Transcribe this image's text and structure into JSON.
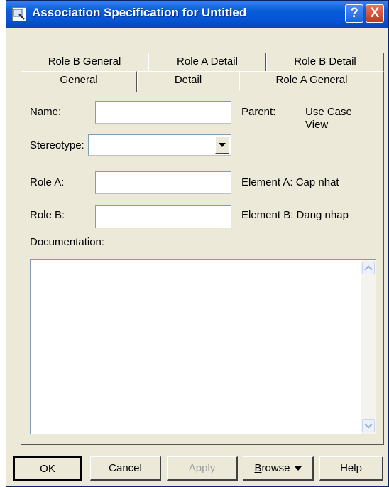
{
  "window": {
    "title": "Association Specification for Untitled",
    "help_glyph": "?",
    "close_glyph": "X"
  },
  "tabs": {
    "back_row": [
      "Role B General",
      "Role A Detail",
      "Role B Detail"
    ],
    "front_row": [
      "General",
      "Detail",
      "Role A General"
    ],
    "active": "General"
  },
  "form": {
    "name_label": "Name:",
    "name_value": "",
    "parent_label": "Parent:",
    "parent_value_line1": "Use Case",
    "parent_value_line2": "View",
    "stereotype_label": "Stereotype:",
    "stereotype_value": "",
    "role_a_label": "Role A:",
    "role_a_value": "",
    "element_a_text": "Element A: Cap nhat",
    "role_b_label": "Role B:",
    "role_b_value": "",
    "element_b_text": "Element B: Dang nhap",
    "documentation_label": "Documentation:",
    "documentation_value": ""
  },
  "buttons": {
    "ok": "OK",
    "cancel": "Cancel",
    "apply": "Apply",
    "browse_first": "B",
    "browse_rest": "rowse",
    "help": "Help"
  },
  "icons": {
    "app": "magnifier-icon",
    "help": "help-icon",
    "close": "close-icon",
    "combo": "chevron-down-icon"
  }
}
